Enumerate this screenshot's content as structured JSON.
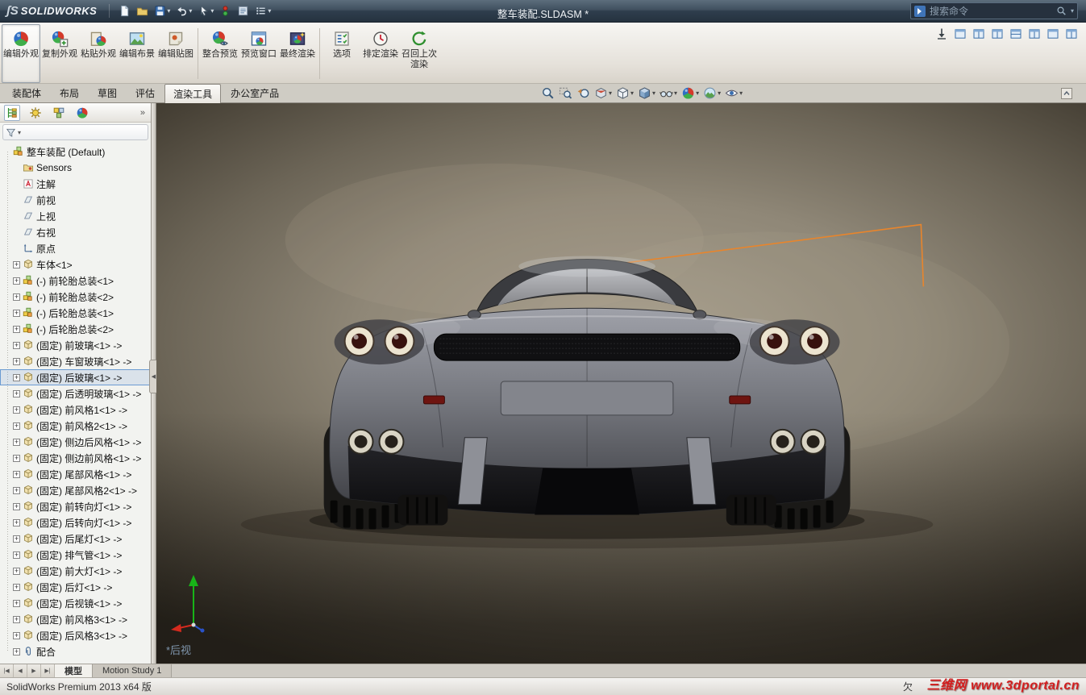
{
  "colors": {
    "annotation_line": "#e8852c",
    "watermark_red": "#d21f1f",
    "selection_blue": "#6b9bd2",
    "titlebar_dark": "#2f3e4d"
  },
  "titlebar": {
    "logo_glyph": "ʃS",
    "logo_text": "SOLIDWORKS",
    "title": "整车装配.SLDASM *",
    "search": {
      "placeholder": "搜索命令"
    },
    "quick_icons": [
      {
        "name": "new-document-icon",
        "icon": "doc"
      },
      {
        "name": "open-icon",
        "icon": "folder"
      },
      {
        "name": "save-icon",
        "icon": "floppy",
        "dd": true
      },
      {
        "name": "undo-icon",
        "icon": "undo",
        "dd": true
      },
      {
        "name": "select-cursor-icon",
        "icon": "cursor",
        "dd": true
      },
      {
        "name": "rebuild-icon",
        "icon": "rebuild"
      },
      {
        "name": "file-properties-icon",
        "icon": "tag"
      },
      {
        "name": "options-list-icon",
        "icon": "list",
        "dd": true
      }
    ]
  },
  "window_toolbar": {
    "icons": [
      {
        "name": "save-image-icon",
        "icon": "down-arrow"
      },
      {
        "name": "window-tile-icon",
        "icon": "bluewin"
      },
      {
        "name": "window-split-vertical-icon",
        "icon": "bluewin2"
      },
      {
        "name": "window-split-vertical-2-icon",
        "icon": "bluewin2"
      },
      {
        "name": "window-split-horizontal-icon",
        "icon": "bluewin3"
      },
      {
        "name": "window-cascade-icon",
        "icon": "bluewin2"
      },
      {
        "name": "window-single-icon",
        "icon": "bluewin"
      },
      {
        "name": "window-arrange-icon",
        "icon": "bluewin2"
      }
    ]
  },
  "ribbon": {
    "buttons": [
      {
        "label": "编辑外观",
        "name": "edit-appearance-button",
        "icon": "sphere",
        "pressed": true
      },
      {
        "label": "复制外观",
        "name": "copy-appearance-button",
        "icon": "sphere-copy"
      },
      {
        "label": "粘贴外观",
        "name": "paste-appearance-button",
        "icon": "sphere-paste"
      },
      {
        "label": "编辑布景",
        "name": "edit-scene-button",
        "icon": "scene"
      },
      {
        "label": "编辑贴图",
        "name": "edit-decal-button",
        "icon": "decal",
        "sep_after": true
      },
      {
        "label": "整合预览",
        "name": "integrated-preview-button",
        "icon": "preview"
      },
      {
        "label": "预览窗口",
        "name": "preview-window-button",
        "icon": "window"
      },
      {
        "label": "最终渲染",
        "name": "final-render-button",
        "icon": "render",
        "sep_after": true
      },
      {
        "label": "选项",
        "name": "render-options-button",
        "icon": "options"
      },
      {
        "label": "排定渲染",
        "name": "schedule-render-button",
        "icon": "clock"
      },
      {
        "label": "召回上次渲染",
        "name": "recall-last-render-button",
        "icon": "recall"
      }
    ],
    "tabs": [
      {
        "label": "装配体",
        "name": "tab-assembly"
      },
      {
        "label": "布局",
        "name": "tab-layout"
      },
      {
        "label": "草图",
        "name": "tab-sketch"
      },
      {
        "label": "评估",
        "name": "tab-evaluate"
      },
      {
        "label": "渲染工具",
        "name": "tab-render-tools",
        "active": true
      },
      {
        "label": "办公室产品",
        "name": "tab-office-products"
      }
    ]
  },
  "headsup": {
    "icons": [
      {
        "name": "zoom-fit-icon",
        "icon": "magnifier"
      },
      {
        "name": "zoom-area-icon",
        "icon": "magnifier-area"
      },
      {
        "name": "previous-view-icon",
        "icon": "prev-view"
      },
      {
        "name": "section-view-icon",
        "icon": "section",
        "dd": true
      },
      {
        "name": "view-orientation-icon",
        "icon": "cube",
        "dd": true
      },
      {
        "name": "display-style-icon",
        "icon": "cube-shaded",
        "dd": true
      },
      {
        "name": "hide-show-items-icon",
        "icon": "glasses",
        "dd": true
      },
      {
        "name": "edit-appearance-icon",
        "icon": "sphere",
        "dd": true
      },
      {
        "name": "apply-scene-icon",
        "icon": "scene-ball",
        "dd": true
      },
      {
        "name": "view-settings-icon",
        "icon": "camera",
        "dd": true
      }
    ]
  },
  "panel": {
    "overflow": "»",
    "tabs": [
      {
        "name": "feature-manager-tab",
        "icon": "fm",
        "active": true
      },
      {
        "name": "property-manager-tab",
        "icon": "pm"
      },
      {
        "name": "configuration-manager-tab",
        "icon": "cm"
      },
      {
        "name": "display-manager-tab",
        "icon": "dm"
      }
    ],
    "tree": [
      {
        "label": "整车装配 (Default)",
        "icon": "asm",
        "level": 0
      },
      {
        "label": "Sensors",
        "icon": "sensors",
        "level": 1
      },
      {
        "label": "注解",
        "icon": "annotations",
        "level": 1
      },
      {
        "label": "前视",
        "icon": "plane",
        "level": 1
      },
      {
        "label": "上视",
        "icon": "plane",
        "level": 1
      },
      {
        "label": "右视",
        "icon": "plane",
        "level": 1
      },
      {
        "label": "原点",
        "icon": "origin",
        "level": 1
      },
      {
        "label": "车体<1>",
        "icon": "part",
        "level": 1,
        "exp": true
      },
      {
        "label": "(-) 前轮胎总装<1>",
        "icon": "asm",
        "level": 1,
        "exp": true
      },
      {
        "label": "(-) 前轮胎总装<2>",
        "icon": "asm",
        "level": 1,
        "exp": true
      },
      {
        "label": "(-) 后轮胎总装<1>",
        "icon": "asm",
        "level": 1,
        "exp": true
      },
      {
        "label": "(-) 后轮胎总装<2>",
        "icon": "asm",
        "level": 1,
        "exp": true
      },
      {
        "label": "(固定) 前玻璃<1> ->",
        "icon": "part",
        "level": 1,
        "exp": true
      },
      {
        "label": "(固定) 车窗玻璃<1> ->",
        "icon": "part",
        "level": 1,
        "exp": true
      },
      {
        "label": "(固定) 后玻璃<1> ->",
        "icon": "part",
        "level": 1,
        "exp": true,
        "selected": true
      },
      {
        "label": "(固定) 后透明玻璃<1> ->",
        "icon": "part",
        "level": 1,
        "exp": true
      },
      {
        "label": "(固定) 前风格1<1> ->",
        "icon": "part",
        "level": 1,
        "exp": true
      },
      {
        "label": "(固定) 前风格2<1> ->",
        "icon": "part",
        "level": 1,
        "exp": true
      },
      {
        "label": "(固定) 侧边后风格<1> ->",
        "icon": "part",
        "level": 1,
        "exp": true
      },
      {
        "label": "(固定) 侧边前风格<1> ->",
        "icon": "part",
        "level": 1,
        "exp": true
      },
      {
        "label": "(固定) 尾部风格<1> ->",
        "icon": "part",
        "level": 1,
        "exp": true
      },
      {
        "label": "(固定) 尾部风格2<1> ->",
        "icon": "part",
        "level": 1,
        "exp": true
      },
      {
        "label": "(固定) 前转向灯<1> ->",
        "icon": "part",
        "level": 1,
        "exp": true
      },
      {
        "label": "(固定) 后转向灯<1> ->",
        "icon": "part",
        "level": 1,
        "exp": true
      },
      {
        "label": "(固定) 后尾灯<1> ->",
        "icon": "part",
        "level": 1,
        "exp": true
      },
      {
        "label": "(固定) 排气管<1> ->",
        "icon": "part",
        "level": 1,
        "exp": true
      },
      {
        "label": "(固定) 前大灯<1> ->",
        "icon": "part",
        "level": 1,
        "exp": true
      },
      {
        "label": "(固定) 后灯<1> ->",
        "icon": "part",
        "level": 1,
        "exp": true
      },
      {
        "label": "(固定) 后视镜<1> ->",
        "icon": "part",
        "level": 1,
        "exp": true
      },
      {
        "label": "(固定) 前风格3<1> ->",
        "icon": "part",
        "level": 1,
        "exp": true
      },
      {
        "label": "(固定) 后风格3<1> ->",
        "icon": "part",
        "level": 1,
        "exp": true
      },
      {
        "label": "配合",
        "icon": "mates",
        "level": 1,
        "exp": true
      }
    ]
  },
  "viewport": {
    "view_label": "*后视"
  },
  "bottom": {
    "nav": [
      {
        "name": "first-tab-icon",
        "glyph": "|◀"
      },
      {
        "name": "prev-tab-icon",
        "glyph": "◀"
      },
      {
        "name": "next-tab-icon",
        "glyph": "▶"
      },
      {
        "name": "last-tab-icon",
        "glyph": "▶|"
      }
    ],
    "tabs": [
      {
        "label": "模型",
        "name": "tab-model",
        "active": true
      },
      {
        "label": "Motion Study 1",
        "name": "tab-motion-study-1"
      }
    ]
  },
  "statusbar": {
    "left": "SolidWorks Premium 2013 x64 版",
    "right": "欠",
    "watermark": "三维网 www.3dportal.cn"
  }
}
